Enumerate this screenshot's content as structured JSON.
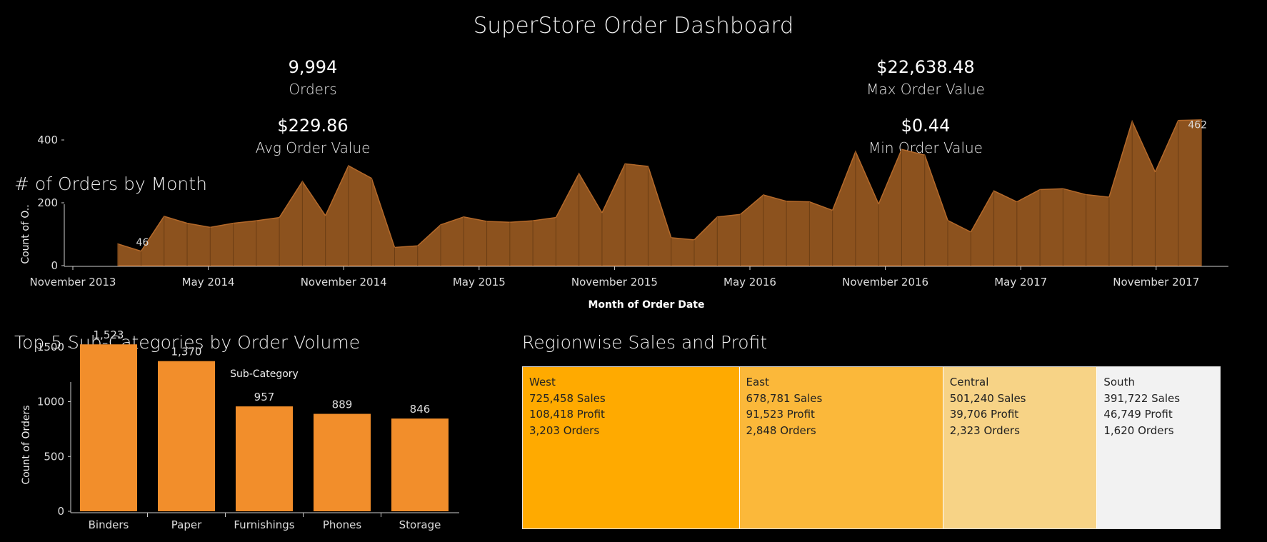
{
  "dashboard": {
    "title": "SuperStore Order Dashboard"
  },
  "kpis": {
    "orders": {
      "value": "9,994",
      "label": "Orders"
    },
    "avg_order_value": {
      "value": "$229.86",
      "label": "Avg Order Value"
    },
    "max_order_value": {
      "value": "$22,638.48",
      "label": "Max Order Value"
    },
    "min_order_value": {
      "value": "$0.44",
      "label": "Min Order Value"
    }
  },
  "colors": {
    "background": "#000000",
    "area_fill": "#8c521e",
    "area_stroke": "#b4692a",
    "bar_fill": "#f28e2b",
    "west": "#ffaa00",
    "east": "#fbb83a",
    "central": "#f7d386",
    "south": "#f2f2f2"
  },
  "chart_data": [
    {
      "id": "orders-by-month",
      "type": "area",
      "title": "# of Orders by Month",
      "xlabel": "Month of Order Date",
      "ylabel": "Count of O..",
      "ylim": [
        0,
        450
      ],
      "yticks": [
        0,
        200,
        400
      ],
      "xtick_labels": [
        "November 2013",
        "May 2014",
        "November 2014",
        "May 2015",
        "November 2015",
        "May 2016",
        "November 2016",
        "May 2017",
        "November 2017"
      ],
      "xtick_indices": [
        0,
        6,
        12,
        18,
        24,
        30,
        36,
        42,
        48
      ],
      "x_start_index": 2,
      "x_end_index": 50,
      "months": [
        "2014-01",
        "2014-02",
        "2014-03",
        "2014-04",
        "2014-05",
        "2014-06",
        "2014-07",
        "2014-08",
        "2014-09",
        "2014-10",
        "2014-11",
        "2014-12",
        "2015-01",
        "2015-02",
        "2015-03",
        "2015-04",
        "2015-05",
        "2015-06",
        "2015-07",
        "2015-08",
        "2015-09",
        "2015-10",
        "2015-11",
        "2015-12",
        "2016-01",
        "2016-02",
        "2016-03",
        "2016-04",
        "2016-05",
        "2016-06",
        "2016-07",
        "2016-08",
        "2016-09",
        "2016-10",
        "2016-11",
        "2016-12",
        "2017-01",
        "2017-02",
        "2017-03",
        "2017-04",
        "2017-05",
        "2017-06",
        "2017-07",
        "2017-08",
        "2017-09",
        "2017-10",
        "2017-11",
        "2017-12"
      ],
      "values": [
        69,
        46,
        157,
        135,
        122,
        135,
        143,
        153,
        268,
        159,
        318,
        278,
        58,
        63,
        130,
        155,
        141,
        138,
        143,
        153,
        293,
        168,
        324,
        316,
        89,
        82,
        155,
        163,
        225,
        205,
        203,
        176,
        363,
        196,
        370,
        352,
        144,
        107,
        238,
        203,
        242,
        245,
        226,
        218,
        459,
        298,
        462,
        464
      ],
      "data_labels": [
        {
          "index": 1,
          "text": "46"
        },
        {
          "index": 46,
          "text": "462"
        }
      ]
    },
    {
      "id": "top-subcategories",
      "type": "bar",
      "title": "Top-5 Sub-Categories by Order Volume",
      "header": "Sub-Category",
      "ylabel": "Count of Orders",
      "ylim": [
        0,
        1700
      ],
      "yticks": [
        0,
        500,
        1000,
        1500
      ],
      "categories": [
        "Binders",
        "Paper",
        "Furnishings",
        "Phones",
        "Storage"
      ],
      "values": [
        1523,
        1370,
        957,
        889,
        846
      ],
      "value_labels": [
        "1,523",
        "1,370",
        "957",
        "889",
        "846"
      ]
    },
    {
      "id": "regionwise-sales-profit",
      "type": "treemap",
      "title": "Regionwise Sales and Profit",
      "regions": [
        {
          "name": "West",
          "sales": 725458,
          "profit": 108418,
          "orders": 3203,
          "lines": [
            "West",
            "725,458 Sales",
            "108,418 Profit",
            "3,203 Orders"
          ]
        },
        {
          "name": "East",
          "sales": 678781,
          "profit": 91523,
          "orders": 2848,
          "lines": [
            "East",
            "678,781 Sales",
            "91,523 Profit",
            "2,848 Orders"
          ]
        },
        {
          "name": "Central",
          "sales": 501240,
          "profit": 39706,
          "orders": 2323,
          "lines": [
            "Central",
            "501,240 Sales",
            "39,706 Profit",
            "2,323 Orders"
          ]
        },
        {
          "name": "South",
          "sales": 391722,
          "profit": 46749,
          "orders": 1620,
          "lines": [
            "South",
            "391,722 Sales",
            "46,749 Profit",
            "1,620 Orders"
          ]
        }
      ]
    }
  ]
}
